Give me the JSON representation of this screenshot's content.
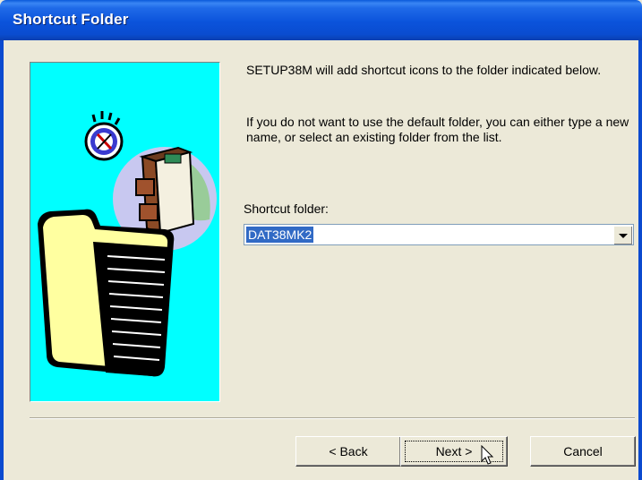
{
  "window": {
    "title": "Shortcut Folder"
  },
  "content": {
    "para1": "SETUP38M will add shortcut icons to the folder indicated below.",
    "para2": "If you do not want to use the default folder, you can either type a new name, or select an existing folder from the list.",
    "field_label": "Shortcut folder:",
    "field_value": "DAT38MK2"
  },
  "buttons": {
    "back": "< Back",
    "next": "Next >",
    "cancel": "Cancel"
  },
  "colors": {
    "title_bar": "#0B53DB",
    "picture_bg": "#00FFFF",
    "selection": "#316AC5",
    "face": "#ECE9D8"
  },
  "icons": {
    "illustration": "folder-clock-cabinet-illustration",
    "dropdown": "chevron-down-icon",
    "cursor": "mouse-pointer-icon"
  }
}
